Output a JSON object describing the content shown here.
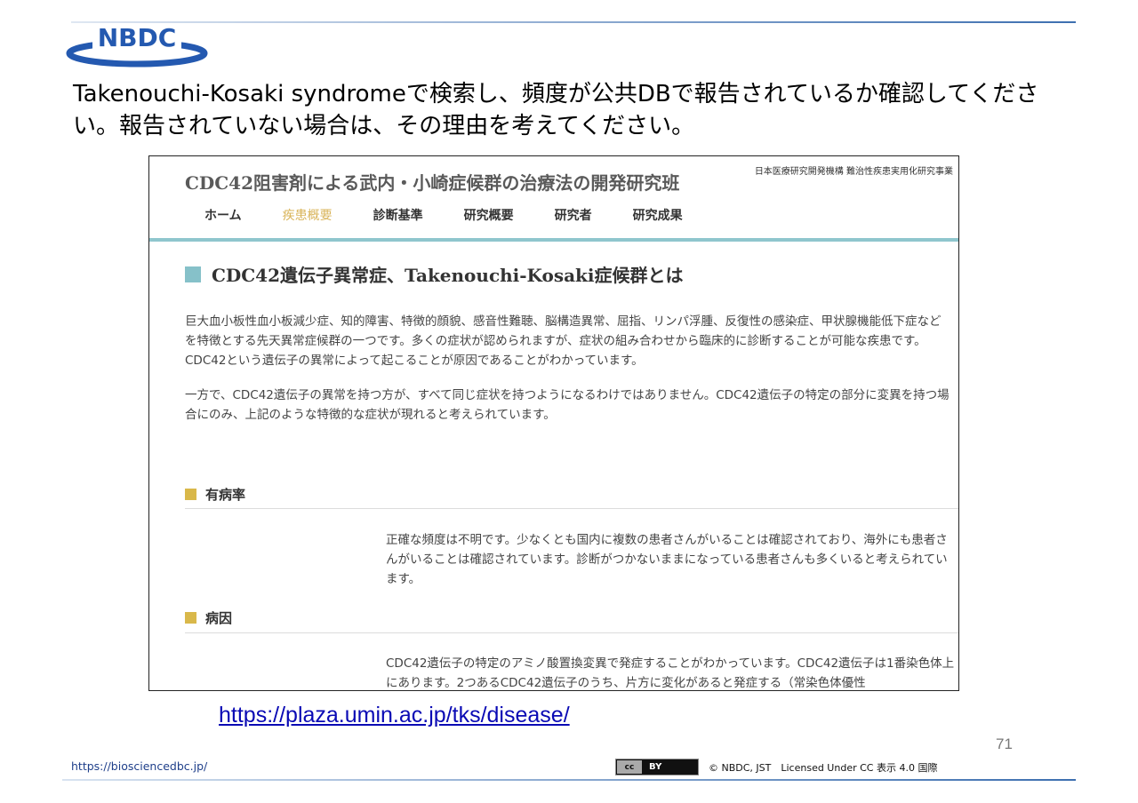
{
  "slide": {
    "logo_text": "NBDC",
    "heading": "Takenouchi-Kosaki syndromeで検索し、頻度が公共DBで報告されているか確認してください。報告されていない場合は、その理由を考えてください。",
    "url": "https://plaza.umin.ac.jp/tks/disease/",
    "page_number": "71",
    "footer_url": "https://biosciencedbc.jp/",
    "cc_badge_left": "cc",
    "cc_badge_right": "BY",
    "license": "© NBDC, JST　Licensed Under CC 表示 4.0 国際"
  },
  "site": {
    "title": "CDC42阻害剤による武内・小崎症候群の治療法の開発研究班",
    "agency": "日本医療研究開発機構 難治性疾患実用化研究事業",
    "nav": [
      "ホーム",
      "疾患概要",
      "診断基準",
      "研究概要",
      "研究者",
      "研究成果"
    ],
    "section_title": "CDC42遺伝子異常症、Takenouchi-Kosaki症候群とは",
    "para1": "巨大血小板性血小板減少症、知的障害、特徴的顔貌、感音性難聴、脳構造異常、屈指、リンパ浮腫、反復性の感染症、甲状腺機能低下症などを特徴とする先天異常症候群の一つです。多くの症状が認められますが、症状の組み合わせから臨床的に診断することが可能な疾患です。CDC42という遺伝子の異常によって起こることが原因であることがわかっています。",
    "para2": "一方で、CDC42遺伝子の異常を持つ方が、すべて同じ症状を持つようになるわけではありません。CDC42遺伝子の特定の部分に変異を持つ場合にのみ、上記のような特徴的な症状が現れると考えられています。",
    "sub1": "有病率",
    "sub1_text": "正確な頻度は不明です。少なくとも国内に複数の患者さんがいることは確認されており、海外にも患者さんがいることは確認されています。診断がつかないままになっている患者さんも多くいると考えられています。",
    "sub2": "病因",
    "sub2_text": "CDC42遺伝子の特定のアミノ酸置換変異で発症することがわかっています。CDC42遺伝子は1番染色体上にあります。2つあるCDC42遺伝子のうち、片方に変化があると発症する（常染色体優性"
  },
  "colors": {
    "accent_teal": "#86c1c9",
    "accent_gold": "#d9b84a",
    "active_nav": "#d9b45a",
    "logo_blue": "#2459b0"
  }
}
